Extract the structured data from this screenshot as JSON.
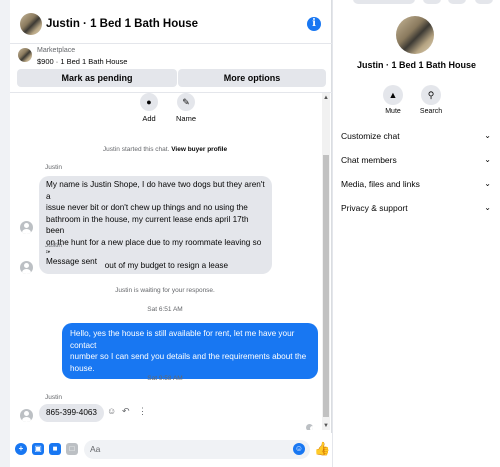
{
  "header": {
    "title": "Justin · 1 Bed 1 Bath House",
    "info_icon": "info-icon"
  },
  "marketplace": {
    "label": "Marketplace",
    "detail": "$900 · 1 Bed 1 Bath House"
  },
  "buttons": {
    "pending": "Mark as pending",
    "more": "More options"
  },
  "profile_actions": [
    {
      "label": "Add",
      "icon": "add-person-icon"
    },
    {
      "label": "Name",
      "icon": "pencil-icon"
    }
  ],
  "notes": {
    "started_prefix": "Justin started this chat.",
    "started_link": "View buyer profile",
    "waiting": "Justin is waiting for your response.",
    "time1": "Sat 6:51 AM",
    "time2": "Sat 9:58 AM"
  },
  "messages": {
    "sender": "Justin",
    "m1": [
      "My name is Justin Shope, I do have two dogs but they aren't a",
      "issue never bit or don't chew up things and no using the",
      "bathroom in the house, my current lease ends april 17th been",
      "on the hunt for a new place due to my roommate leaving so it",
      "would be a little out of my budget to resign a lease"
    ],
    "m2": "Message sent",
    "m3": [
      "Hello, yes the house is still available for rent, let me have your contact",
      "number so I can send you details and the requirements about the",
      "house."
    ],
    "m4": "865-399-4063"
  },
  "composer": {
    "placeholder": "Aa"
  },
  "right_panel": {
    "name": "Justin · 1 Bed 1 Bath House",
    "actions": [
      {
        "label": "Mute",
        "icon": "bell-icon"
      },
      {
        "label": "Search",
        "icon": "search-icon"
      }
    ],
    "sections": [
      "Customize chat",
      "Chat members",
      "Media, files and links",
      "Privacy & support"
    ]
  },
  "colors": {
    "accent": "#1877f2",
    "bubble_in": "#e4e6eb"
  }
}
